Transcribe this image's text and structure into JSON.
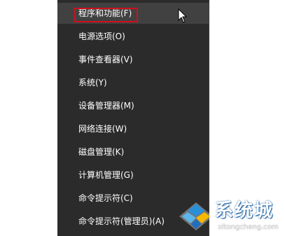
{
  "menu": {
    "items": [
      {
        "label": "程序和功能(F)"
      },
      {
        "label": "电源选项(O)"
      },
      {
        "label": "事件查看器(V)"
      },
      {
        "label": "系统(Y)"
      },
      {
        "label": "设备管理器(M)"
      },
      {
        "label": "网络连接(W)"
      },
      {
        "label": "磁盘管理(K)"
      },
      {
        "label": "计算机管理(G)"
      },
      {
        "label": "命令提示符(C)"
      },
      {
        "label": "命令提示符(管理员)(A)"
      }
    ],
    "highlighted_index": 0
  },
  "watermark": {
    "brand": "系统城",
    "url": "xitongcheng.com"
  },
  "colors": {
    "menu_background": "#2b2b2b",
    "hover_background": "#414141",
    "highlight_border": "#d0101c",
    "text": "#ffffff"
  }
}
